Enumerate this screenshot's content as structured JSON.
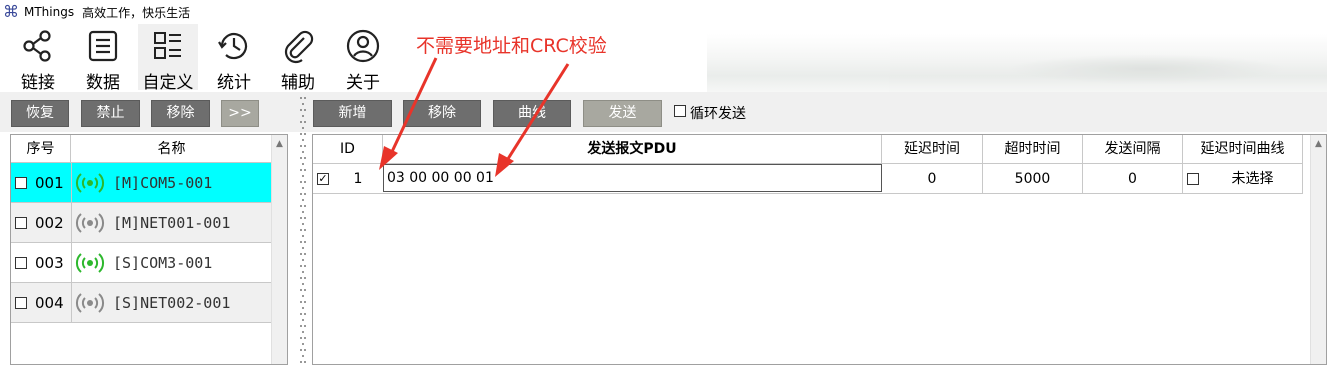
{
  "app": {
    "title": "MThings",
    "slogan": "高效工作，快乐生活",
    "icon": "command-key-icon"
  },
  "ribbon": {
    "items": [
      {
        "label": "链接",
        "icon": "share-icon"
      },
      {
        "label": "数据",
        "icon": "list-document-icon"
      },
      {
        "label": "自定义",
        "icon": "grid-list-icon",
        "active": true
      },
      {
        "label": "统计",
        "icon": "history-clock-icon"
      },
      {
        "label": "辅助",
        "icon": "paperclip-icon"
      },
      {
        "label": "关于",
        "icon": "user-icon"
      }
    ]
  },
  "annotation": {
    "text": "不需要地址和CRC校验",
    "color": "#e8342a"
  },
  "left_toolbar": {
    "restore": "恢复",
    "disable": "禁止",
    "remove": "移除",
    "expand": ">>"
  },
  "right_toolbar": {
    "add": "新增",
    "remove": "移除",
    "curve": "曲线",
    "send": "发送",
    "loop_send": "循环发送"
  },
  "device_list": {
    "headers": {
      "index": "序号",
      "name": "名称"
    },
    "rows": [
      {
        "num": "001",
        "name": "[M]COM5-001",
        "status": "green",
        "selected": true
      },
      {
        "num": "002",
        "name": "[M]NET001-001",
        "status": "gray",
        "selected": false
      },
      {
        "num": "003",
        "name": "[S]COM3-001",
        "status": "green",
        "selected": false
      },
      {
        "num": "004",
        "name": "[S]NET002-001",
        "status": "gray",
        "selected": false
      }
    ]
  },
  "pdu_table": {
    "headers": {
      "id": "ID",
      "pdu": "发送报文PDU",
      "delay": "延迟时间",
      "timeout": "超时时间",
      "interval": "发送间隔",
      "delay_curve": "延迟时间曲线"
    },
    "rows": [
      {
        "checked": true,
        "id": "1",
        "pdu": "03 00 00 00 01",
        "delay": "0",
        "timeout": "5000",
        "interval": "0",
        "curve_checked": false,
        "curve": "未选择"
      }
    ]
  },
  "colors": {
    "selected_row": "#00ffff",
    "status_green": "#2db82d",
    "status_gray": "#8a8a8a",
    "button_dark": "#6e6e6e",
    "button_send": "#a8a8a0"
  }
}
